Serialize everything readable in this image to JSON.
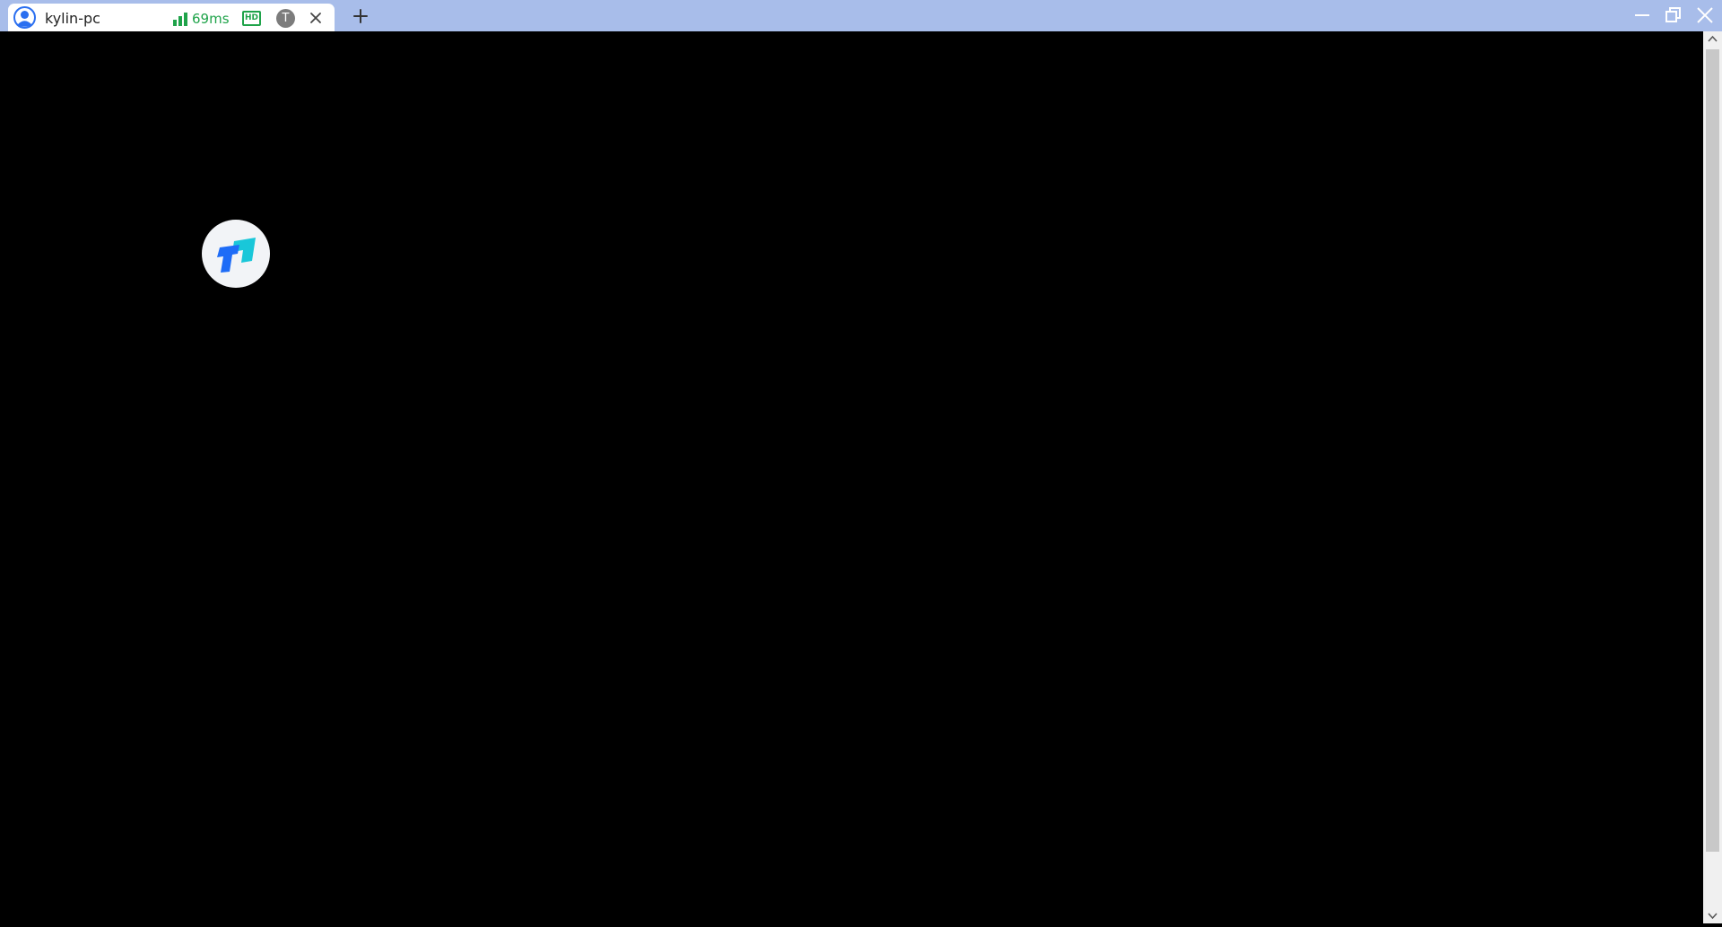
{
  "tab": {
    "title": "kylin-pc",
    "latency": "69ms",
    "quality_badge": "HD",
    "type_badge": "T",
    "avatar_icon": "user-avatar-icon",
    "signal_icon": "signal-bars-icon",
    "close_icon": "close-icon"
  },
  "toolbar": {
    "new_tab_icon": "plus-icon"
  },
  "window_controls": {
    "minimize_icon": "minimize-icon",
    "maximize_icon": "restore-icon",
    "close_icon": "close-icon"
  },
  "remote_desktop": {
    "app_icon": "todesk-logo-icon",
    "background_color": "#000000"
  },
  "colors": {
    "titlebar": "#a8bdea",
    "status_green": "#1fa34a",
    "avatar_blue": "#2a6ff0",
    "logo_blue": "#1e6cf7",
    "logo_cyan": "#19c7d9"
  },
  "scrollbar": {
    "position": 0
  }
}
